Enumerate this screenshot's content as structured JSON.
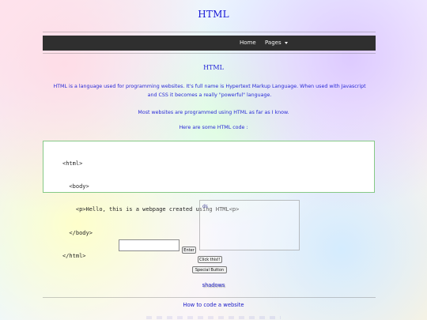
{
  "site": {
    "title": "HTML"
  },
  "navbar": {
    "home_label": "Home",
    "pages_label": "Pages",
    "pages_icon": "chevron-down-icon"
  },
  "content": {
    "section_title": "HTML",
    "intro": "HTML is a language used for programming websites. It's full name is Hypertext Markup Language. When used with Javascript and CSS it becomes a really \"powerful\" language.",
    "paragraph_1": "Most websites are programmed using HTML as far as I know.",
    "paragraph_2": "Here are some HTML code :"
  },
  "code_block": {
    "lines": [
      "<html>",
      "  <body>",
      "    <p>Hello, this is a webpage created using HTML<p>",
      "  </body>",
      "</html>"
    ]
  },
  "form": {
    "textarea_value": "ds",
    "text_input_value": "",
    "enter_label": "Enter",
    "click_label": "Click this!!",
    "special_label": "Special Button"
  },
  "extras": {
    "shadows_text": "shadows"
  },
  "footer": {
    "title": "How to code a website"
  },
  "colors": {
    "text_blue": "#2a2bd7",
    "navbar_bg": "#2f2f2f",
    "code_border": "#86c986"
  }
}
